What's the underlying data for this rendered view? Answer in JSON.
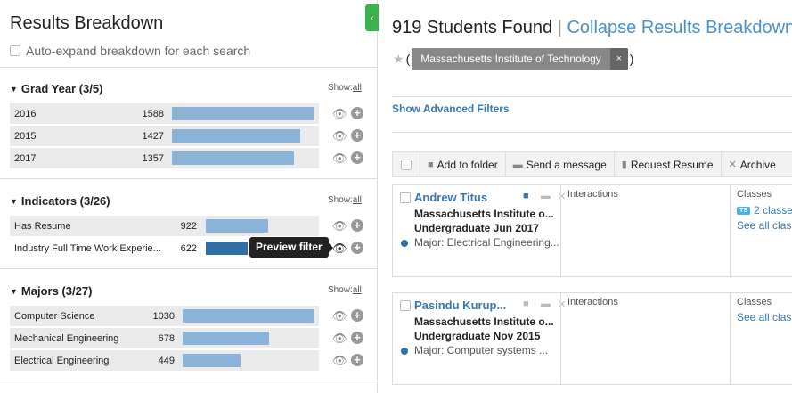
{
  "breakdown": {
    "title": "Results Breakdown",
    "auto_expand_label": "Auto-expand breakdown for each search",
    "sections": [
      {
        "heading": "Grad Year (3/5)",
        "show_label": "Show:",
        "show_link": "all",
        "rows": [
          {
            "label": "2016",
            "count": "1588",
            "value": 1588
          },
          {
            "label": "2015",
            "count": "1427",
            "value": 1427
          },
          {
            "label": "2017",
            "count": "1357",
            "value": 1357
          }
        ]
      },
      {
        "heading": "Indicators (3/26)",
        "show_label": "Show:",
        "show_link": "all",
        "rows": [
          {
            "label": "Has Resume",
            "count": "922",
            "value": 922
          },
          {
            "label": "Industry Full Time Work Experie...",
            "count": "622",
            "value": 622
          }
        ]
      },
      {
        "heading": "Majors (3/27)",
        "show_label": "Show:",
        "show_link": "all",
        "rows": [
          {
            "label": "Computer Science",
            "count": "1030",
            "value": 1030
          },
          {
            "label": "Mechanical Engineering",
            "count": "678",
            "value": 678
          },
          {
            "label": "Electrical Engineering",
            "count": "449",
            "value": 449
          }
        ]
      }
    ],
    "tooltip": "Preview filter"
  },
  "results": {
    "count_text": "919 Students Found",
    "separator": "|",
    "collapse_link": "Collapse Results Breakdown",
    "filter_open": "(",
    "filter_close": ")",
    "filter_chip": "Massachusetts Institute of Technology",
    "chip_remove": "×",
    "advanced_filters": "Show Advanced Filters",
    "toolbar": {
      "add_folder": "Add to folder",
      "send_message": "Send a message",
      "request_resume": "Request Resume",
      "archive": "Archive"
    },
    "columns": {
      "interactions": "Interactions",
      "classes": "Classes"
    },
    "students": [
      {
        "name": "Andrew Titus",
        "school": "Massachusetts Institute o...",
        "grad": "Undergraduate Jun 2017",
        "major": "Major: Electrical Engineering...",
        "classes_badge": "TS",
        "classes_text": "2 classe",
        "see_all": "See all class"
      },
      {
        "name": "Pasindu Kurup...",
        "school": "Massachusetts Institute o...",
        "grad": "Undergraduate Nov 2015",
        "major": "Major: Computer systems ...",
        "see_all": "See all class"
      }
    ]
  },
  "colors": {
    "bar": "#8bb3d8",
    "bar_active": "#2e6fa8",
    "link": "#4a90c8",
    "green_tab": "#3cb34a"
  },
  "icons": [
    "chevron-left-icon",
    "chevron-down-icon",
    "eye-icon",
    "plus-circle-icon",
    "star-icon",
    "folder-icon",
    "message-icon",
    "document-icon",
    "close-icon"
  ]
}
